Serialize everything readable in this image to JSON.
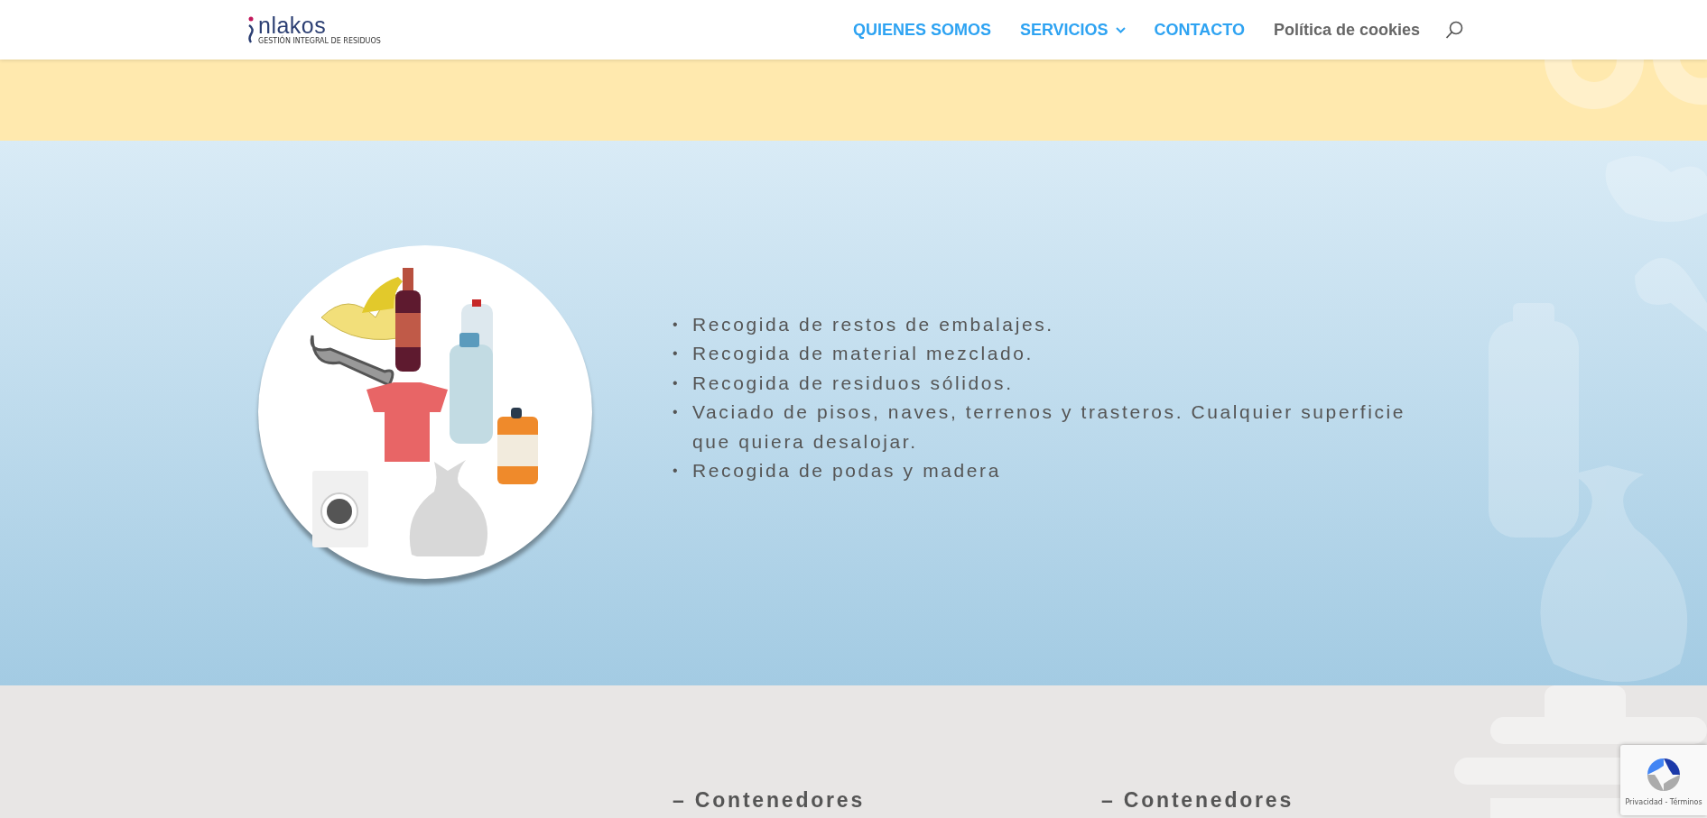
{
  "header": {
    "logo": {
      "name": "nlakos",
      "tagline": "GESTIÓN INTEGRAL DE RESIDUOS"
    },
    "nav": [
      {
        "label": "QUIENES SOMOS",
        "color": "#2ea3f2",
        "has_submenu": false
      },
      {
        "label": "SERVICIOS",
        "color": "#2ea3f2",
        "has_submenu": true
      },
      {
        "label": "CONTACTO",
        "color": "#2ea3f2",
        "has_submenu": false
      },
      {
        "label": "Política de cookies",
        "color": "#666666",
        "has_submenu": false
      }
    ]
  },
  "services": [
    {
      "bullet": "•",
      "text": "Recogida de restos de embalajes."
    },
    {
      "bullet": "•",
      "text": "Recogida de material mezclado."
    },
    {
      "bullet": "•",
      "text": "Recogida de residuos sólidos."
    },
    {
      "bullet": "•",
      "text": "Vaciado de pisos, naves, terrenos y trasteros. Cualquier superficie que quiera desalojar."
    },
    {
      "bullet": "•",
      "text": "Recogida de podas y madera"
    }
  ],
  "headings": [
    "– Contenedores",
    "– Contenedores"
  ],
  "recaptcha": {
    "links": "Privacidad - Términos"
  }
}
